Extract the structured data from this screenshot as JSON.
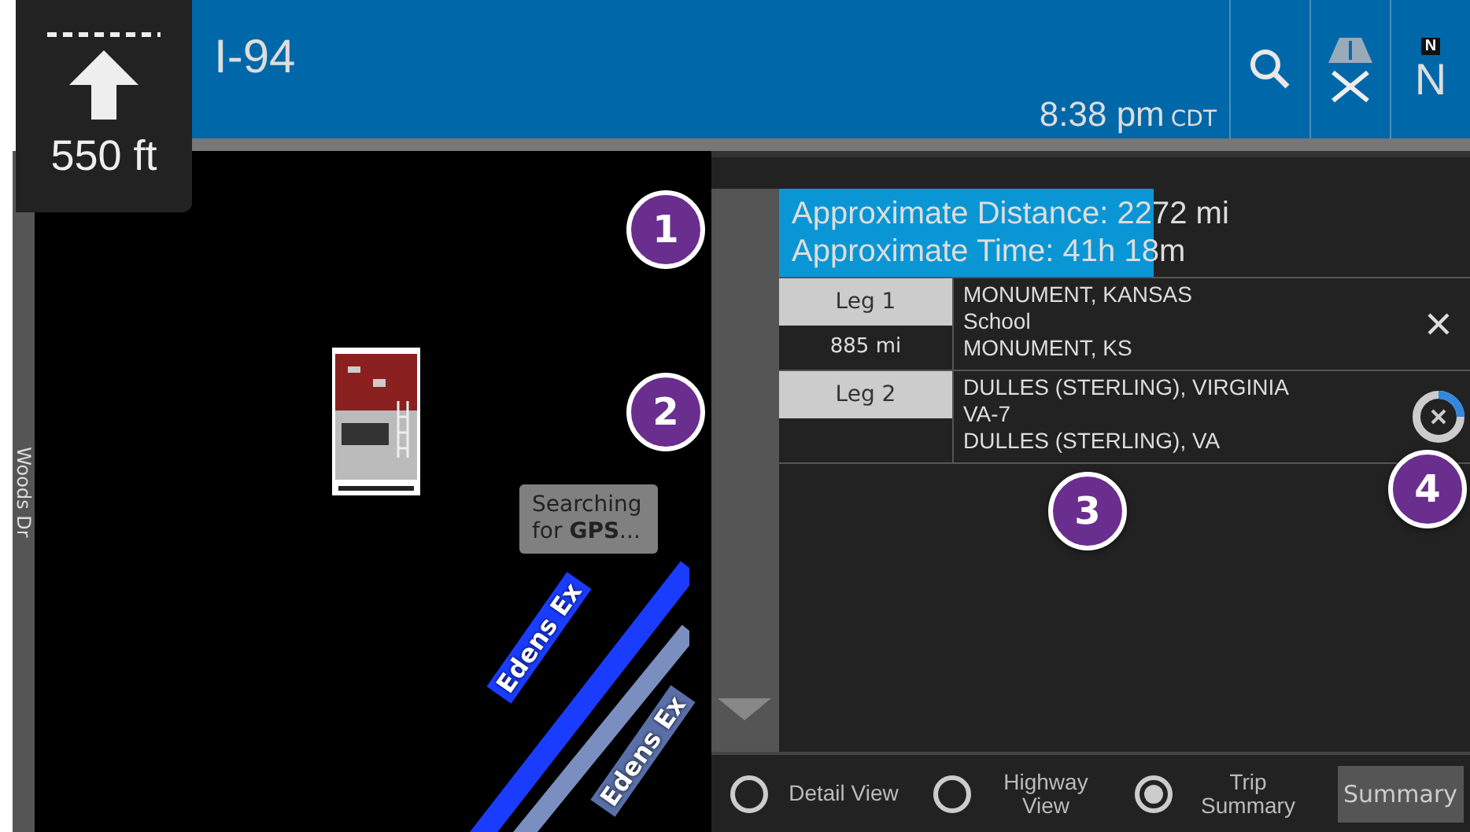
{
  "maneuver": {
    "distance": "550 ft"
  },
  "top_bar": {
    "road": "I-94",
    "time": "8:38 pm",
    "timezone": "CDT",
    "compass": {
      "small": "N",
      "large": "N"
    }
  },
  "map": {
    "street_label": "Woods Dr",
    "road_labels": [
      "Edens Ex",
      "Edens Ex"
    ],
    "gps_status": "Searching for **GPS**..."
  },
  "summary": {
    "distance": "Approximate Distance: 2272 mi",
    "time": "Approximate Time: 41h 18m"
  },
  "legs": [
    {
      "label": "Leg 1",
      "distance": "885 mi",
      "lines": [
        "MONUMENT, KANSAS",
        "School",
        "MONUMENT, KS"
      ],
      "kind": "remove"
    },
    {
      "label": "Leg 2",
      "lines": [
        "DULLES (STERLING), VIRGINIA",
        "VA-7",
        "DULLES (STERLING), VA"
      ],
      "kind": "loading"
    }
  ],
  "view_options": [
    {
      "label": "Detail View",
      "selected": false
    },
    {
      "label": "Highway View",
      "selected": false
    },
    {
      "label": "Trip Summary",
      "selected": true
    }
  ],
  "summary_button": "Summary",
  "callouts": [
    {
      "number": "1"
    },
    {
      "number": "2"
    },
    {
      "number": "3"
    },
    {
      "number": "4"
    }
  ]
}
